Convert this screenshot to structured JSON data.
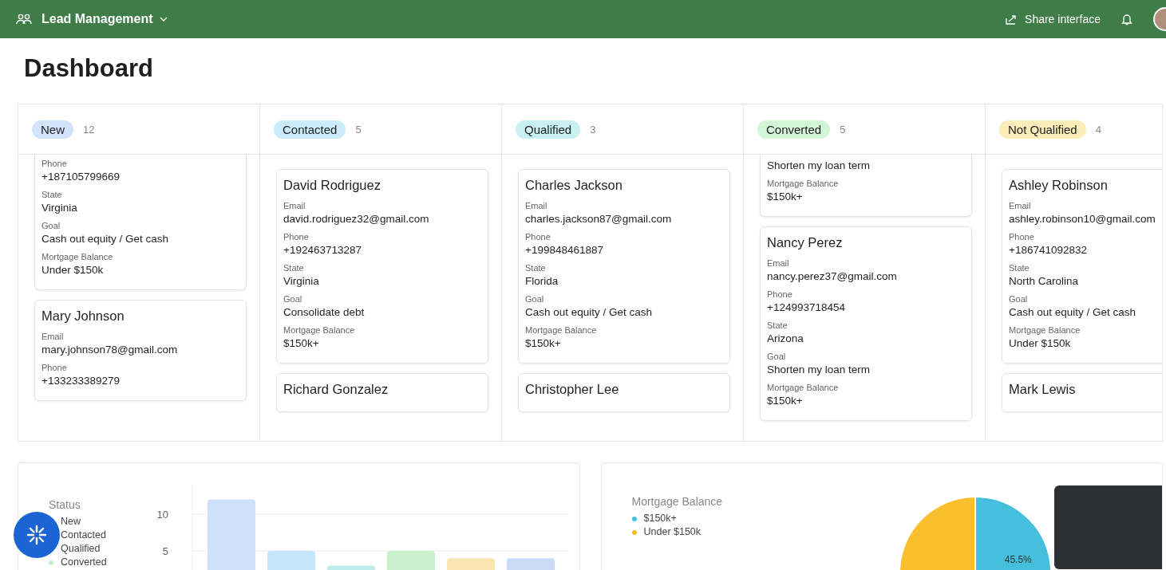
{
  "topbar": {
    "app_name": "Lead Management",
    "share_label": "Share interface"
  },
  "page_title": "Dashboard",
  "board": {
    "columns": [
      {
        "label": "New",
        "count": "12",
        "color": "#d3e3fd",
        "cards": [
          {
            "fields": [
              {
                "label": "Phone",
                "value": "+187105799669"
              },
              {
                "label": "State",
                "value": "Virginia"
              },
              {
                "label": "Goal",
                "value": "Cash out equity / Get cash"
              },
              {
                "label": "Mortgage Balance",
                "value": "Under $150k"
              }
            ]
          },
          {
            "name": "Mary Johnson",
            "fields": [
              {
                "label": "Email",
                "value": "mary.johnson78@gmail.com"
              },
              {
                "label": "Phone",
                "value": "+133233389279"
              }
            ]
          }
        ]
      },
      {
        "label": "Contacted",
        "count": "5",
        "color": "#c9ebfa",
        "cards": [
          {
            "name": "David Rodriguez",
            "fields": [
              {
                "label": "Email",
                "value": "david.rodriguez32@gmail.com"
              },
              {
                "label": "Phone",
                "value": "+192463713287"
              },
              {
                "label": "State",
                "value": "Virginia"
              },
              {
                "label": "Goal",
                "value": "Consolidate debt"
              },
              {
                "label": "Mortgage Balance",
                "value": "$150k+"
              }
            ]
          },
          {
            "name": "Richard Gonzalez"
          }
        ]
      },
      {
        "label": "Qualified",
        "count": "3",
        "color": "#c8f0f0",
        "cards": [
          {
            "name": "Charles Jackson",
            "fields": [
              {
                "label": "Email",
                "value": "charles.jackson87@gmail.com"
              },
              {
                "label": "Phone",
                "value": "+199848461887"
              },
              {
                "label": "State",
                "value": "Florida"
              },
              {
                "label": "Goal",
                "value": "Cash out equity / Get cash"
              },
              {
                "label": "Mortgage Balance",
                "value": "$150k+"
              }
            ]
          },
          {
            "name": "Christopher Lee"
          }
        ]
      },
      {
        "label": "Converted",
        "count": "5",
        "color": "#d2f5d6",
        "cards": [
          {
            "fields": [
              {
                "value": "Shorten my loan term"
              },
              {
                "label": "Mortgage Balance",
                "value": "$150k+"
              }
            ]
          },
          {
            "name": "Nancy Perez",
            "fields": [
              {
                "label": "Email",
                "value": "nancy.perez37@gmail.com"
              },
              {
                "label": "Phone",
                "value": "+124993718454"
              },
              {
                "label": "State",
                "value": "Arizona"
              },
              {
                "label": "Goal",
                "value": "Shorten my loan term"
              },
              {
                "label": "Mortgage Balance",
                "value": "$150k+"
              }
            ]
          }
        ]
      },
      {
        "label": "Not Qualified",
        "count": "4",
        "color": "#fbecb8",
        "cards": [
          {
            "name": "Ashley Robinson",
            "fields": [
              {
                "label": "Email",
                "value": "ashley.robinson10@gmail.com"
              },
              {
                "label": "Phone",
                "value": "+186741092832"
              },
              {
                "label": "State",
                "value": "North Carolina"
              },
              {
                "label": "Goal",
                "value": "Cash out equity / Get cash"
              },
              {
                "label": "Mortgage Balance",
                "value": "Under $150k"
              }
            ]
          },
          {
            "name": "Mark Lewis"
          }
        ]
      }
    ]
  },
  "status_chart": {
    "legend": [
      {
        "label": "New"
      },
      {
        "label": "Contacted"
      },
      {
        "label": "Qualified"
      },
      {
        "label": "Converted"
      }
    ],
    "chart_data": {
      "type": "bar",
      "title": "Status",
      "values": [
        12,
        5,
        3,
        5,
        4,
        4
      ],
      "yticks": [
        5,
        10
      ],
      "ylim": [
        0,
        14
      ]
    }
  },
  "mortgage_chart": {
    "legend": [
      {
        "label": "$150k+",
        "color": "#45c0dc"
      },
      {
        "label": "Under $150k",
        "color": "#f9bf2c"
      }
    ],
    "chart_data": {
      "type": "pie",
      "title": "Mortgage Balance",
      "values": [
        45.5,
        54.5
      ],
      "value_labels": [
        "45.5%",
        null
      ]
    }
  }
}
